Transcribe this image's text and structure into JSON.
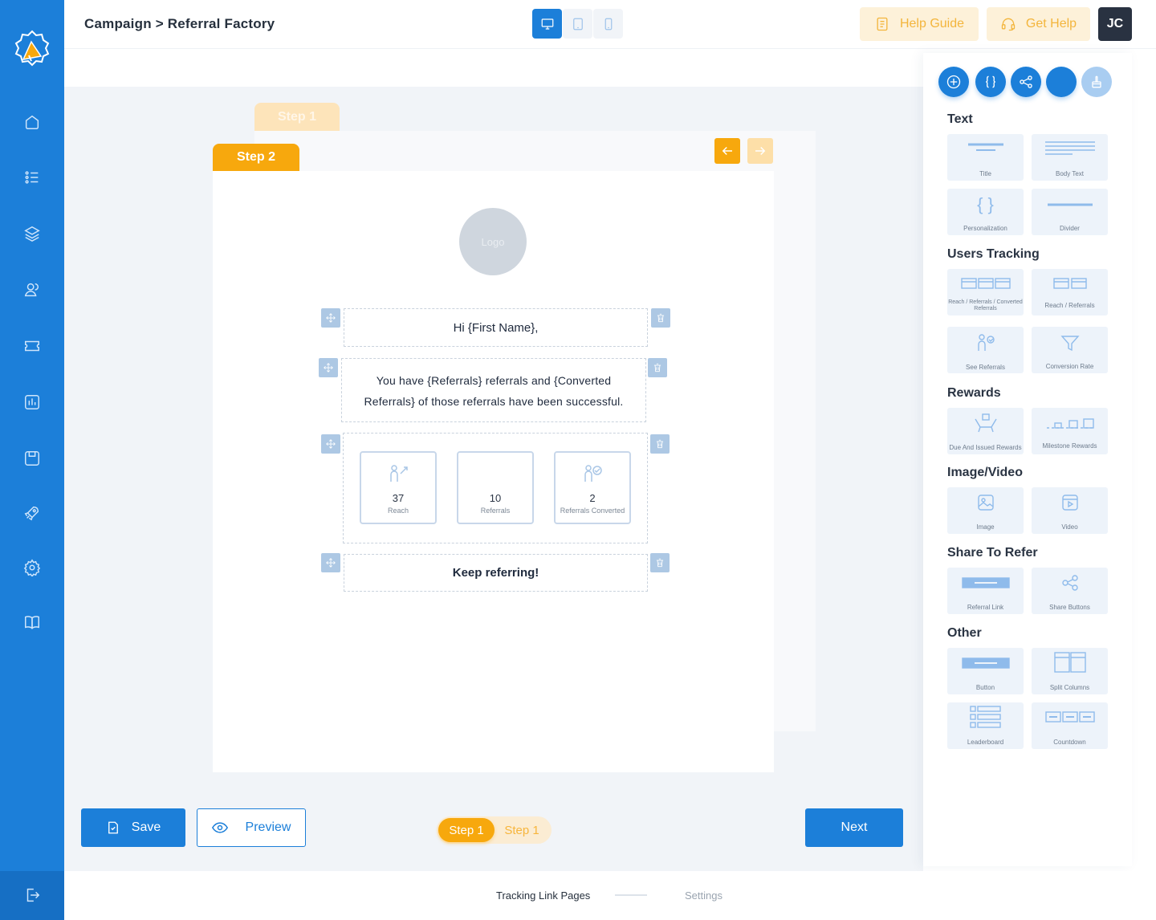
{
  "header": {
    "breadcrumb": "Campaign > Referral Factory",
    "help_guide": "Help Guide",
    "get_help": "Get Help",
    "avatar_initials": "JC",
    "devices": [
      "desktop-icon",
      "tablet-icon",
      "mobile-icon"
    ],
    "active_device": "desktop"
  },
  "sidebar": {
    "items": [
      "home-icon",
      "list-icon",
      "layers-icon",
      "users-icon",
      "ticket-icon",
      "analytics-icon",
      "save-icon",
      "rocket-icon",
      "settings-icon",
      "book-icon"
    ],
    "logout": "logout-icon"
  },
  "editor": {
    "back_tab": "Step 1",
    "front_tab": "Step 2",
    "logo_text": "Logo",
    "greeting": "Hi {First Name},",
    "message_line1": "You have {Referrals} referrals and {Converted",
    "message_line2": "Referrals} of those referrals have been successful.",
    "stats": [
      {
        "value": "37",
        "label": "Reach"
      },
      {
        "value": "10",
        "label": "Referrals"
      },
      {
        "value": "2",
        "label": "Referrals Converted"
      }
    ],
    "closing": "Keep referring!"
  },
  "panel": {
    "sections": {
      "text": {
        "title": "Text",
        "tiles": [
          "Title",
          "Body Text",
          "Personalization",
          "Divider"
        ]
      },
      "tracking": {
        "title": "Users Tracking",
        "tiles": [
          "Reach / Referrals / Converted Referrals",
          "Reach / Referrals",
          "See Referrals",
          "Conversion Rate"
        ]
      },
      "rewards": {
        "title": "Rewards",
        "tiles": [
          "Due And Issued Rewards",
          "Milestone Rewards"
        ]
      },
      "media": {
        "title": "Image/Video",
        "tiles": [
          "Image",
          "Video"
        ]
      },
      "share": {
        "title": "Share To Refer",
        "tiles": [
          "Referral Link",
          "Share Buttons"
        ]
      },
      "other": {
        "title": "Other",
        "tiles": [
          "Button",
          "Split Columns",
          "Leaderboard",
          "Countdown"
        ]
      }
    },
    "personalization_glyph": "{ }"
  },
  "footer": {
    "save": "Save",
    "preview": "Preview",
    "step_active": "Step 1",
    "step_inactive": "Step 1",
    "next": "Next",
    "nav_current": "Tracking Link Pages",
    "nav_next": "Settings"
  },
  "colors": {
    "primary": "#1c7fd9",
    "accent": "#f7a80d",
    "accent_light": "#fdd79a"
  }
}
